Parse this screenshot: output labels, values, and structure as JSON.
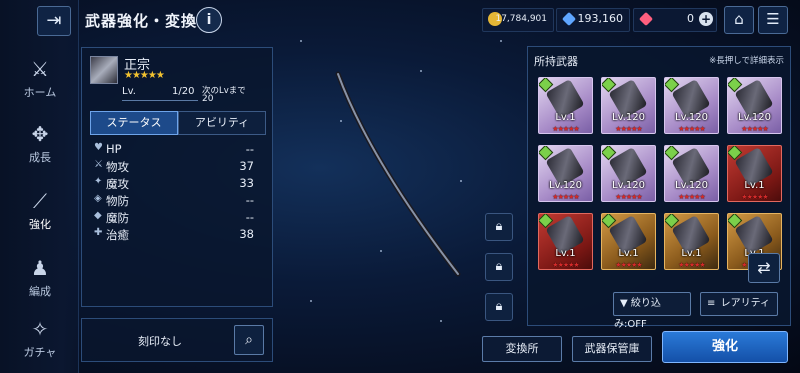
{
  "header": {
    "title": "武器強化・変換",
    "info_icon": "i"
  },
  "currency": {
    "gold": "17,784,901",
    "crystal": "193,160",
    "gem": "0"
  },
  "nav": [
    {
      "label": "ホーム",
      "icon": "home-icon"
    },
    {
      "label": "成長",
      "icon": "growth-icon"
    },
    {
      "label": "強化",
      "icon": "enhance-icon"
    },
    {
      "label": "編成",
      "icon": "party-icon"
    },
    {
      "label": "ガチャ",
      "icon": "gacha-icon"
    }
  ],
  "weapon": {
    "name": "正宗",
    "stars": "★★★★★",
    "lv_label": "Lv.",
    "lv_value": "1/20",
    "next_label": "次のLvまで",
    "next_value": "20"
  },
  "tabs": {
    "status": "ステータス",
    "ability": "アビリティ"
  },
  "stats": [
    {
      "icon": "♥",
      "label": "HP",
      "value": "--"
    },
    {
      "icon": "⚔",
      "label": "物攻",
      "value": "37"
    },
    {
      "icon": "✦",
      "label": "魔攻",
      "value": "33"
    },
    {
      "icon": "◈",
      "label": "物防",
      "value": "--"
    },
    {
      "icon": "◆",
      "label": "魔防",
      "value": "--"
    },
    {
      "icon": "✚",
      "label": "治癒",
      "value": "38"
    }
  ],
  "engrave": {
    "label": "刻印なし"
  },
  "owned": {
    "title": "所持武器",
    "hint": "※長押しで詳細表示"
  },
  "cards": [
    {
      "lv": "Lv.1",
      "color": "purple",
      "stars": "★★★★★"
    },
    {
      "lv": "Lv.120",
      "color": "purple",
      "stars": "★★★★★"
    },
    {
      "lv": "Lv.120",
      "color": "purple",
      "stars": "★★★★★"
    },
    {
      "lv": "Lv.120",
      "color": "purple",
      "stars": "★★★★★"
    },
    {
      "lv": "Lv.120",
      "color": "purple",
      "stars": "★★★★★"
    },
    {
      "lv": "Lv.120",
      "color": "purple",
      "stars": "★★★★★"
    },
    {
      "lv": "Lv.120",
      "color": "purple",
      "stars": "★★★★★"
    },
    {
      "lv": "Lv.1",
      "color": "red",
      "stars": "★★★★★"
    },
    {
      "lv": "Lv.1",
      "color": "red",
      "stars": "★★★★★"
    },
    {
      "lv": "Lv.1",
      "color": "gold",
      "stars": "★★★★★"
    },
    {
      "lv": "Lv.1",
      "color": "gold",
      "stars": "★★★★★"
    },
    {
      "lv": "Lv.1",
      "color": "gold",
      "stars": "★★★★★"
    }
  ],
  "filter": {
    "refine": "絞り込み:OFF",
    "sort": "レアリティ"
  },
  "buttons": {
    "exchange": "変換所",
    "storage": "武器保管庫",
    "enhance": "強化"
  }
}
